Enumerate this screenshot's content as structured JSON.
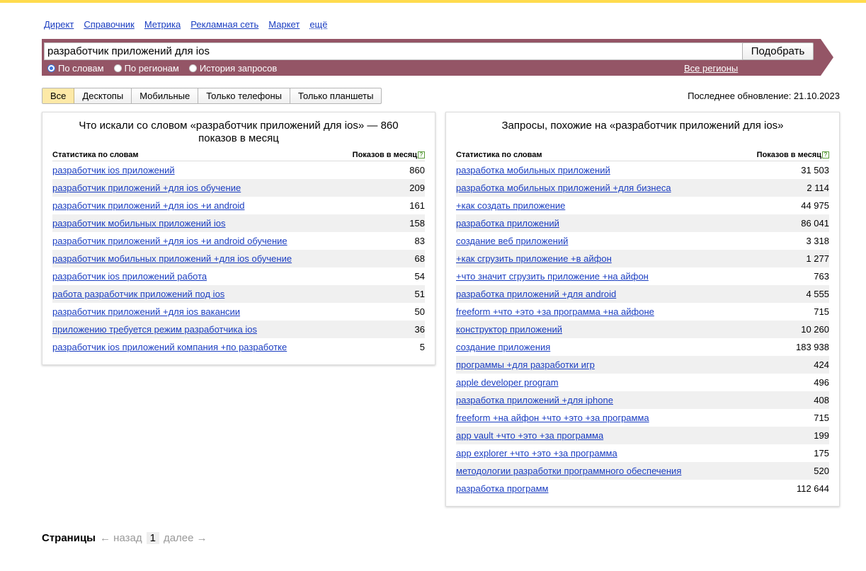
{
  "services": [
    "Директ",
    "Справочник",
    "Метрика",
    "Рекламная сеть",
    "Маркет",
    "ещё"
  ],
  "search": {
    "query": "разработчик приложений для ios",
    "button": "Подобрать",
    "radios": [
      {
        "label": "По словам",
        "checked": true
      },
      {
        "label": "По регионам",
        "checked": false
      },
      {
        "label": "История запросов",
        "checked": false
      }
    ],
    "regions": "Все регионы",
    "band_color": "#945566"
  },
  "tabs": [
    "Все",
    "Десктопы",
    "Мобильные",
    "Только телефоны",
    "Только планшеты"
  ],
  "active_tab": "Все",
  "updated": "Последнее обновление: 21.10.2023",
  "left": {
    "title": "Что искали со словом «разработчик приложений для ios» — 860 показов в месяц",
    "col1": "Статистика по словам",
    "col2": "Показов в месяц",
    "rows": [
      {
        "q": "разработчик ios приложений",
        "n": "860"
      },
      {
        "q": "разработчик приложений +для ios обучение",
        "n": "209"
      },
      {
        "q": "разработчик приложений +для ios +и android",
        "n": "161"
      },
      {
        "q": "разработчик мобильных приложений ios",
        "n": "158"
      },
      {
        "q": "разработчик приложений +для ios +и android обучение",
        "n": "83"
      },
      {
        "q": "разработчик мобильных приложений +для ios обучение",
        "n": "68"
      },
      {
        "q": "разработчик ios приложений работа",
        "n": "54"
      },
      {
        "q": "работа разработчик приложений под ios",
        "n": "51"
      },
      {
        "q": "разработчик приложений +для ios вакансии",
        "n": "50"
      },
      {
        "q": "приложению требуется режим разработчика ios",
        "n": "36"
      },
      {
        "q": "разработчик ios приложений компания +по разработке",
        "n": "5"
      }
    ]
  },
  "right": {
    "title": "Запросы, похожие на «разработчик приложений для ios»",
    "col1": "Статистика по словам",
    "col2": "Показов в месяц",
    "rows": [
      {
        "q": "разработка мобильных приложений",
        "n": "31 503"
      },
      {
        "q": "разработка мобильных приложений +для бизнеса",
        "n": "2 114"
      },
      {
        "q": "+как создать приложение",
        "n": "44 975"
      },
      {
        "q": "разработка приложений",
        "n": "86 041"
      },
      {
        "q": "создание веб приложений",
        "n": "3 318"
      },
      {
        "q": "+как сгрузить приложение +в айфон",
        "n": "1 277"
      },
      {
        "q": "+что значит сгрузить приложение +на айфон",
        "n": "763"
      },
      {
        "q": "разработка приложений +для android",
        "n": "4 555"
      },
      {
        "q": "freeform +что +это +за программа +на айфоне",
        "n": "715"
      },
      {
        "q": "конструктор приложений",
        "n": "10 260"
      },
      {
        "q": "создание приложения",
        "n": "183 938"
      },
      {
        "q": "программы +для разработки игр",
        "n": "424"
      },
      {
        "q": "apple developer program",
        "n": "496"
      },
      {
        "q": "разработка приложений +для iphone",
        "n": "408"
      },
      {
        "q": "freeform +на айфон +что +это +за программа",
        "n": "715"
      },
      {
        "q": "app vault +что +это +за программа",
        "n": "199"
      },
      {
        "q": "app explorer +что +это +за программа",
        "n": "175"
      },
      {
        "q": "методологии разработки программного обеспечения",
        "n": "520"
      },
      {
        "q": "разработка программ",
        "n": "112 644"
      }
    ]
  },
  "pager": {
    "label": "Страницы",
    "prev": "← назад",
    "current": "1",
    "next": "далее →"
  }
}
